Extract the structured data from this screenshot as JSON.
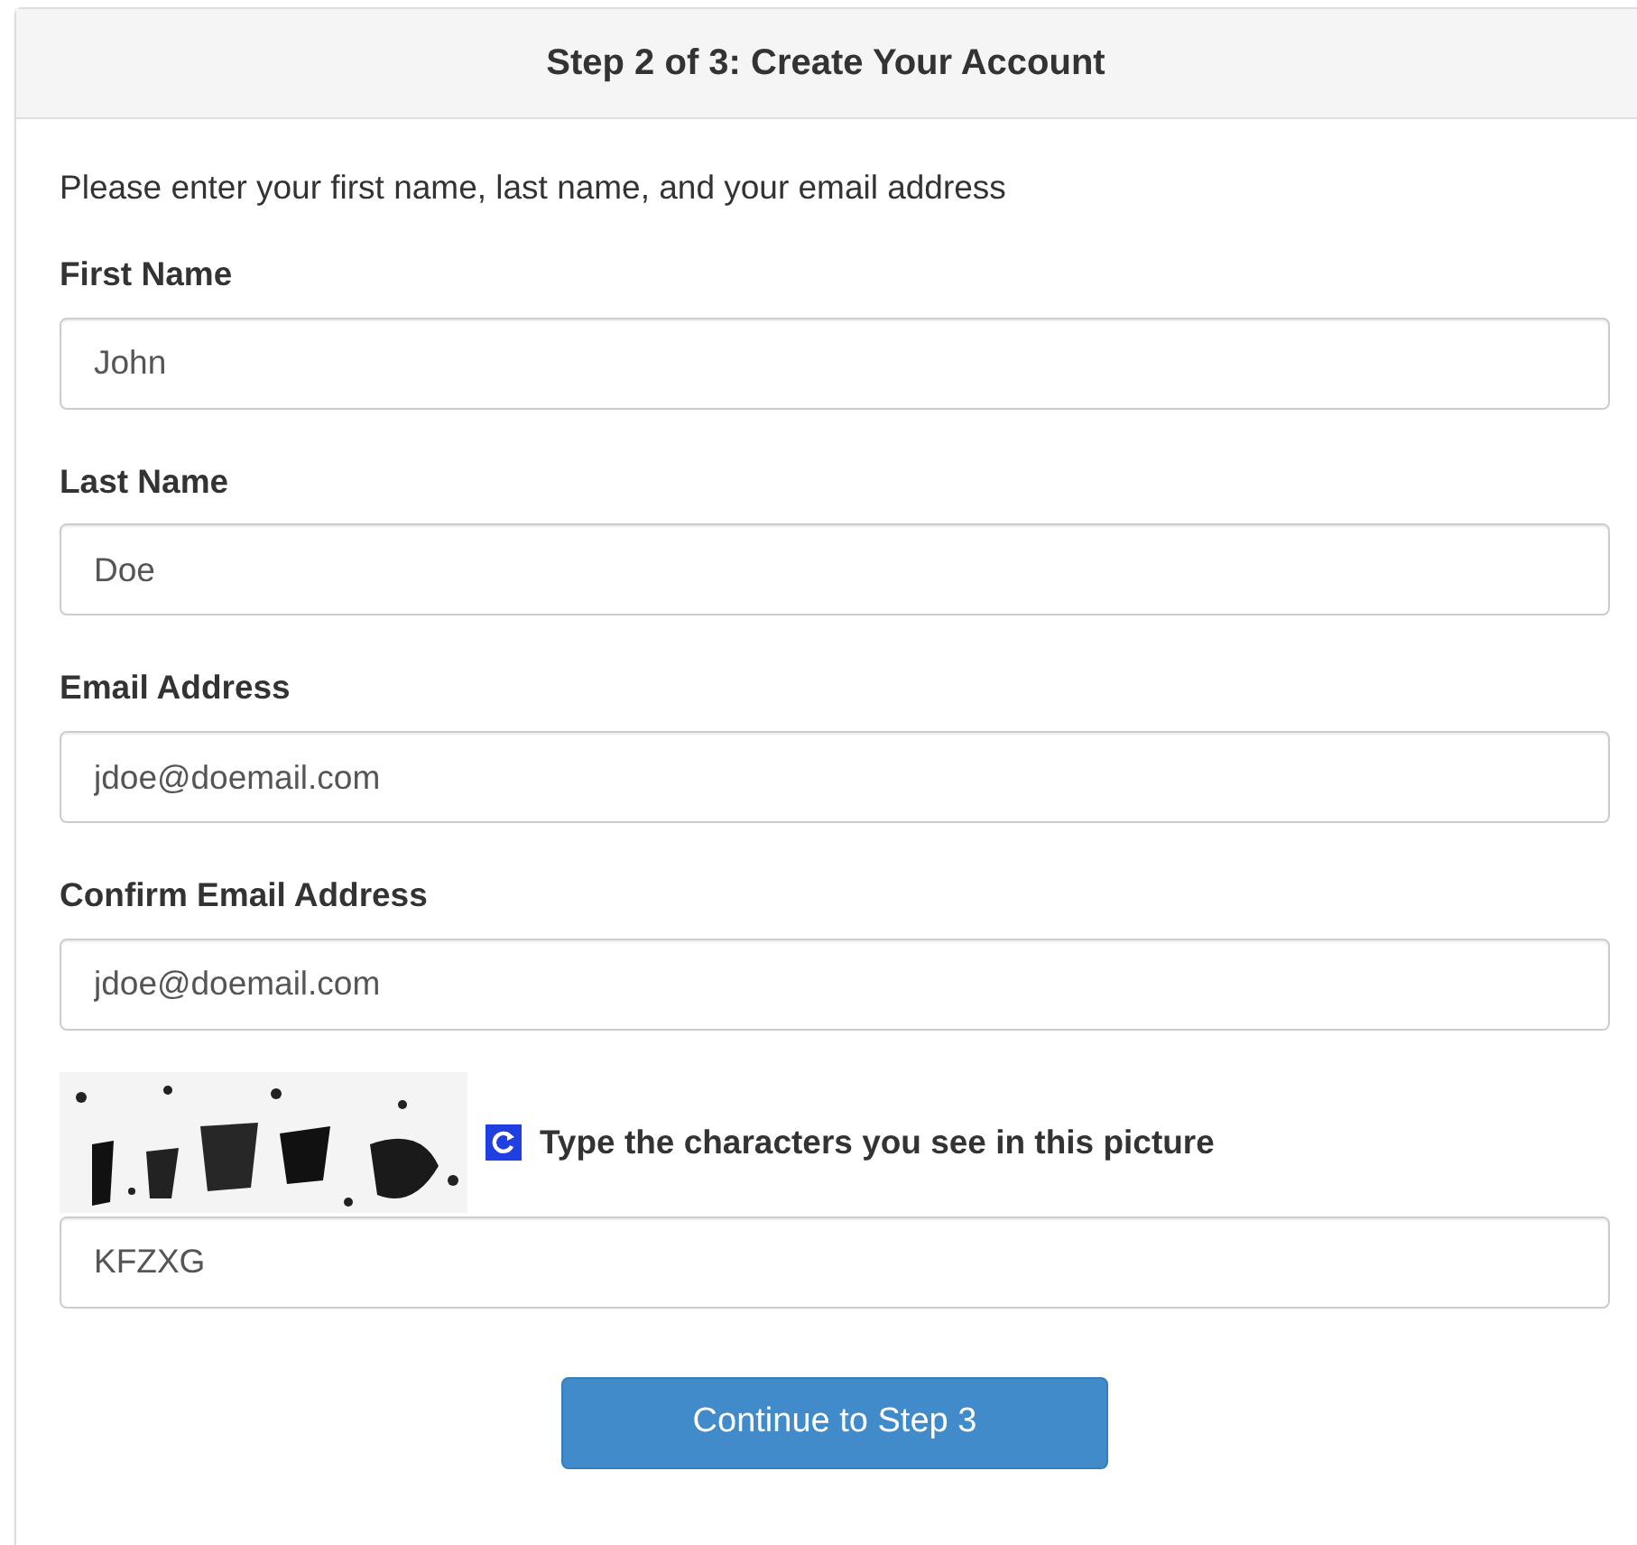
{
  "header": {
    "title": "Step 2 of 3: Create Your Account"
  },
  "intro": "Please enter your first name, last name, and your email address",
  "fields": [
    {
      "label": "First Name",
      "value": "John"
    },
    {
      "label": "Last Name",
      "value": "Doe"
    },
    {
      "label": "Email Address",
      "value": "jdoe@doemail.com"
    },
    {
      "label": "Confirm Email Address",
      "value": "jdoe@doemail.com"
    }
  ],
  "captcha": {
    "prompt": "Type the characters you see in this picture",
    "value": "KFZXG"
  },
  "button": "Continue to Step 3"
}
